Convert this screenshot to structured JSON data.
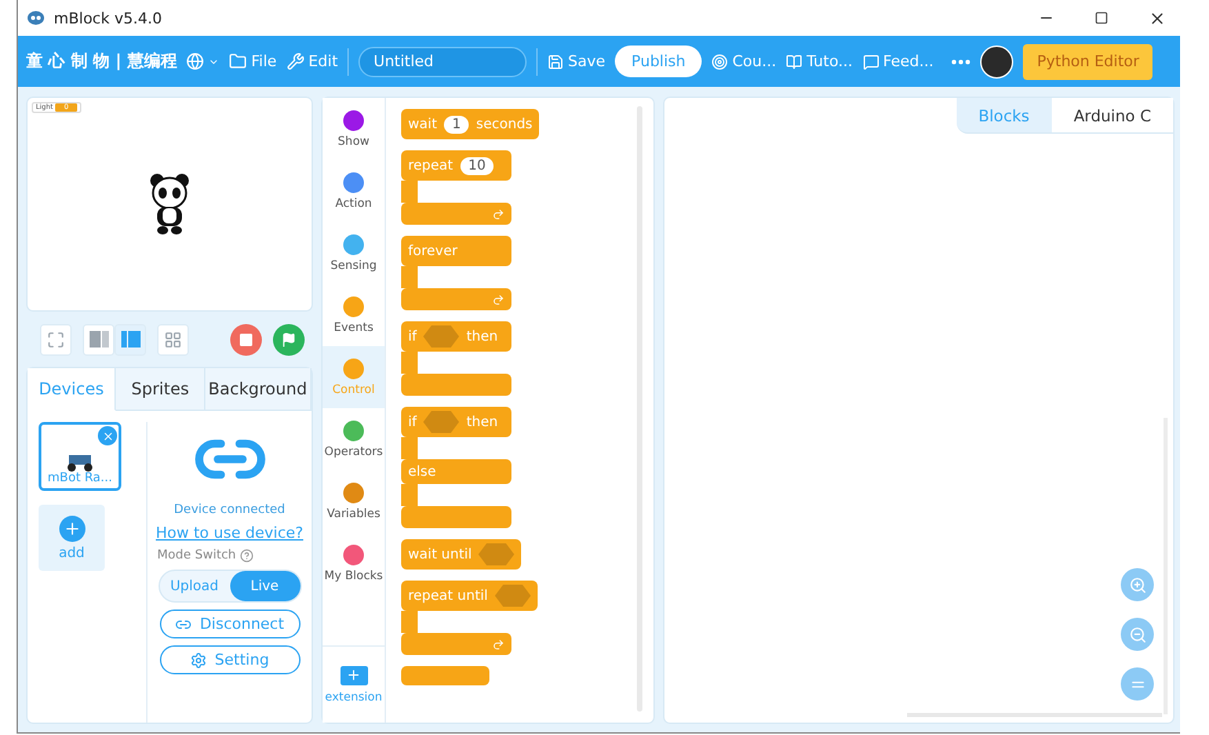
{
  "window": {
    "title": "mBlock v5.4.0"
  },
  "menu_bar": {
    "brand": "童 心 制 物 | 慧编程",
    "items": [
      {
        "kind": "globe"
      },
      {
        "kind": "folder",
        "label": "File"
      },
      {
        "kind": "wrench",
        "label": "Edit"
      }
    ],
    "project_name": {
      "value": "Untitled"
    },
    "save": "Save",
    "publish": "Publish",
    "links": [
      {
        "kind": "course",
        "label": "Cou..."
      },
      {
        "kind": "book",
        "label": "Tuto..."
      },
      {
        "kind": "chat",
        "label": "Feed..."
      }
    ],
    "python_editor": "Python Editor"
  },
  "stage": {
    "monitor": {
      "label": "Light",
      "value": "0"
    },
    "view_buttons": [
      {
        "kind": "fullscreen",
        "selected": false
      },
      {
        "kind": "small-stage",
        "selected": false
      },
      {
        "kind": "large-stage",
        "selected": true
      },
      {
        "kind": "grid",
        "selected": false
      }
    ]
  },
  "sprite_panel": {
    "tabs": [
      {
        "label": "Devices",
        "selected": true
      },
      {
        "label": "Sprites",
        "selected": false
      },
      {
        "label": "Background",
        "selected": false
      }
    ],
    "devices": [
      {
        "name": "mBot Ra...",
        "selected": true
      }
    ],
    "add": "add",
    "status": "Device connected",
    "help_link": "How to use device?",
    "mode_label": "Mode Switch",
    "modes": [
      {
        "label": "Upload",
        "selected": false
      },
      {
        "label": "Live",
        "selected": true
      }
    ],
    "disconnect": "Disconnect",
    "setting": "Setting"
  },
  "categories": [
    {
      "name": "Show",
      "color": "#9b19e6",
      "selected": false
    },
    {
      "name": "Action",
      "color": "#4c8ff5",
      "selected": false
    },
    {
      "name": "Sensing",
      "color": "#43b2ef",
      "selected": false
    },
    {
      "name": "Events",
      "color": "#f7a516",
      "selected": false
    },
    {
      "name": "Control",
      "color": "#f7a516",
      "selected": true
    },
    {
      "name": "Operators",
      "color": "#4cbb59",
      "selected": false
    },
    {
      "name": "Variables",
      "color": "#e08a14",
      "selected": false
    },
    {
      "name": "My Blocks",
      "color": "#f2577a",
      "selected": false
    }
  ],
  "extension": "extension",
  "blocks": [
    {
      "kind": "stack",
      "parts": [
        {
          "kind": "text",
          "text": "wait"
        },
        {
          "kind": "number",
          "text": "1"
        },
        {
          "kind": "text",
          "text": "seconds"
        }
      ]
    },
    {
      "kind": "loop",
      "parts": [
        {
          "kind": "text",
          "text": "repeat"
        },
        {
          "kind": "number",
          "text": "10"
        }
      ]
    },
    {
      "kind": "loop",
      "parts": [
        {
          "kind": "text",
          "text": "forever"
        }
      ]
    },
    {
      "kind": "if",
      "parts": [
        {
          "kind": "text",
          "text": "if"
        },
        {
          "kind": "condition"
        },
        {
          "kind": "text",
          "text": "then"
        }
      ]
    },
    {
      "kind": "if-else",
      "else": "else",
      "parts": [
        {
          "kind": "text",
          "text": "if"
        },
        {
          "kind": "condition"
        },
        {
          "kind": "text",
          "text": "then"
        }
      ]
    },
    {
      "kind": "stack",
      "parts": [
        {
          "kind": "text",
          "text": "wait until"
        },
        {
          "kind": "condition"
        }
      ]
    },
    {
      "kind": "loop",
      "parts": [
        {
          "kind": "text",
          "text": "repeat until"
        },
        {
          "kind": "condition"
        }
      ]
    },
    {
      "kind": "cut"
    }
  ],
  "canvas": {
    "tabs": [
      {
        "label": "Blocks",
        "selected": true
      },
      {
        "label": "Arduino C",
        "selected": false
      }
    ],
    "zoom_buttons": [
      {
        "kind": "zoom-in"
      },
      {
        "kind": "zoom-out"
      },
      {
        "kind": "reset"
      }
    ]
  }
}
